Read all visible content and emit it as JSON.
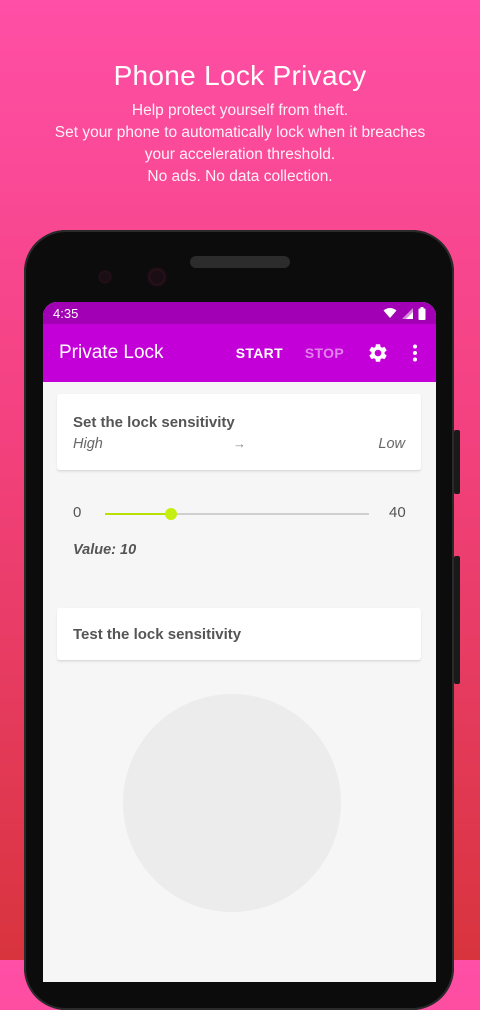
{
  "promo": {
    "title": "Phone Lock Privacy",
    "lines": [
      "Help protect yourself from theft.",
      "Set your phone to automatically lock when it breaches",
      "your acceleration threshold.",
      "No ads. No data collection."
    ]
  },
  "status_bar": {
    "time": "4:35",
    "icons": [
      "wifi-icon",
      "signal-icon",
      "battery-icon"
    ]
  },
  "app_bar": {
    "title": "Private Lock",
    "start_label": "START",
    "stop_label": "STOP",
    "icons": [
      "gear-icon",
      "more-vert-icon"
    ]
  },
  "sensitivity": {
    "title": "Set the lock sensitivity",
    "high_label": "High",
    "arrow": "→",
    "low_label": "Low",
    "min": "0",
    "max": "40",
    "value": 10,
    "value_label": "Value: 10"
  },
  "test": {
    "title": "Test the lock sensitivity"
  },
  "colors": {
    "status_bar": "#a100b4",
    "app_bar": "#c400d8",
    "slider_accent": "#c5ef10"
  }
}
